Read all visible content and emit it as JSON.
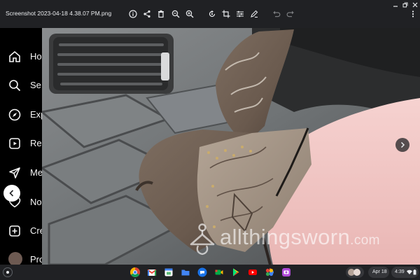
{
  "window": {
    "title": "Screenshot 2023-04-18 4.38.07 PM.png",
    "toolbar": [
      "info-icon",
      "share-icon",
      "delete-icon",
      "zoom-out-icon",
      "zoom-in-icon",
      "rotate-icon",
      "crop-icon",
      "adjust-icon",
      "markup-icon",
      "undo-icon",
      "redo-icon",
      "more-vert-icon"
    ],
    "controls": [
      "minimize-icon",
      "restore-icon",
      "close-icon"
    ]
  },
  "background_app": {
    "nav": [
      {
        "icon": "home-icon",
        "label": "Ho"
      },
      {
        "icon": "search-icon",
        "label": "Se"
      },
      {
        "icon": "explore-icon",
        "label": "Exp"
      },
      {
        "icon": "reels-icon",
        "label": "Re"
      },
      {
        "icon": "messages-icon",
        "label": "Me"
      },
      {
        "icon": "notifications-icon",
        "label": "No"
      },
      {
        "icon": "create-icon",
        "label": "Cre"
      },
      {
        "icon": "profile-avatar",
        "label": "Pro"
      }
    ]
  },
  "viewer": {
    "image_subject": "cowboy-boot-photo",
    "watermark_text": "allthingsworn",
    "watermark_suffix": ".com"
  },
  "shelf": {
    "apps": [
      "chrome-icon",
      "gmail-icon",
      "calendar-icon",
      "files-icon",
      "messages-app-icon",
      "meet-icon",
      "play-store-icon",
      "youtube-icon",
      "photos-icon",
      "camera-icon"
    ],
    "date": "Apr 18",
    "time": "4:39"
  },
  "colors": {
    "titlebar": "#202124",
    "accent_pink": "#f2c4c4",
    "shelf": "#202124"
  }
}
